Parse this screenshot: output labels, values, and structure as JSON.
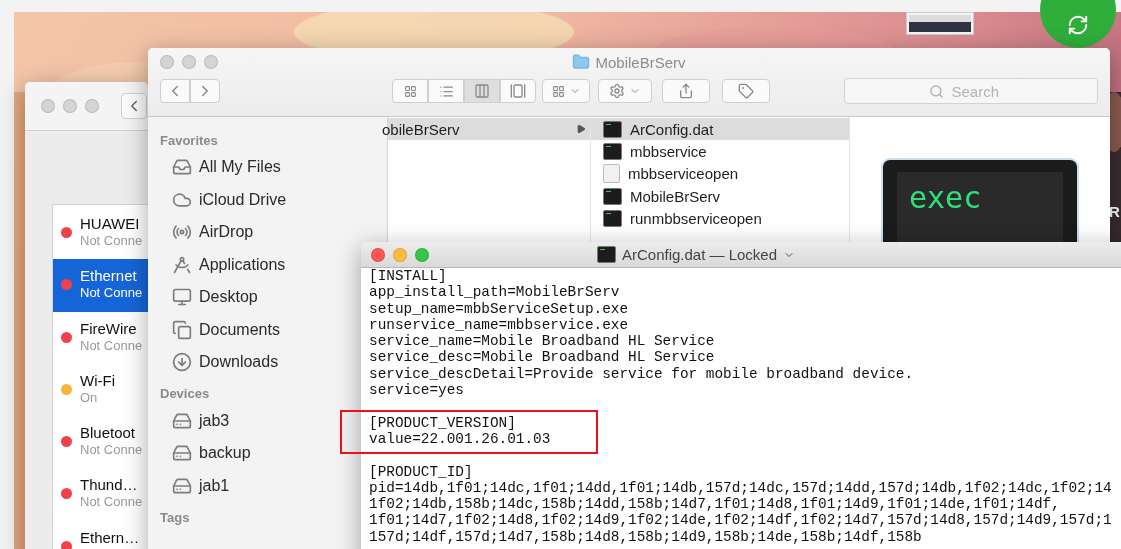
{
  "desktop": {
    "label": "R"
  },
  "network_window": {
    "items": [
      {
        "name": "HUAWEI",
        "status": "Not Conne",
        "color": "#f0414a",
        "selected": false
      },
      {
        "name": "Ethernet",
        "status": "Not Conne",
        "color": "#f0414a",
        "selected": true
      },
      {
        "name": "FireWire",
        "status": "Not Conne",
        "color": "#f0414a",
        "selected": false
      },
      {
        "name": "Wi-Fi",
        "status": "On",
        "color": "#f5b43c",
        "selected": false
      },
      {
        "name": "Bluetoot",
        "status": "Not Conne",
        "color": "#f0414a",
        "selected": false
      },
      {
        "name": "Thund…",
        "status": "Not Conne",
        "color": "#f0414a",
        "selected": false
      },
      {
        "name": "Ethern…",
        "color": "#f0414a",
        "selected": false
      }
    ]
  },
  "finder": {
    "title": "MobileBrServ",
    "search": {
      "placeholder": "Search"
    },
    "sidebar": [
      {
        "heading": "Favorites",
        "items": [
          "All My Files",
          "iCloud Drive",
          "AirDrop",
          "Applications",
          "Desktop",
          "Documents",
          "Downloads"
        ]
      },
      {
        "heading": "Devices",
        "items": [
          "jab3",
          "backup",
          "jab1"
        ]
      },
      {
        "heading": "Tags"
      }
    ],
    "columns": [
      {
        "items": [
          {
            "name": "obileBrServ",
            "kind": "folder",
            "selected": true
          }
        ]
      },
      {
        "items": [
          {
            "name": "ArConfig.dat",
            "kind": "terminal",
            "selected": true
          },
          {
            "name": "mbbservice",
            "kind": "terminal",
            "selected": false
          },
          {
            "name": "mbbserviceopen",
            "kind": "script",
            "selected": false
          },
          {
            "name": "MobileBrServ",
            "kind": "terminal",
            "selected": false
          },
          {
            "name": "runmbbserviceopen",
            "kind": "terminal",
            "selected": false
          }
        ]
      }
    ],
    "preview": {
      "text": "exec"
    }
  },
  "textedit": {
    "title": "ArConfig.dat — Locked",
    "sections": [
      {
        "highlighted": false,
        "lines": [
          "[INSTALL]",
          "app_install_path=MobileBrServ",
          "setup_name=mbbServiceSetup.exe",
          "runservice_name=mbbservice.exe",
          "service_name=Mobile Broadband HL Service",
          "service_desc=Mobile Broadband HL Service",
          "service_descDetail=Provide service for mobile broadband device.",
          "service=yes"
        ]
      },
      {
        "highlighted": true,
        "lines": [
          "[PRODUCT_VERSION]",
          "value=22.001.26.01.03"
        ]
      },
      {
        "highlighted": false,
        "lines": [
          "[PRODUCT_ID]",
          "pid=14db,1f01;14dc,1f01;14dd,1f01;14db,157d;14dc,157d;14dd,157d;14db,1f02;14dc,1f02;14",
          "1f02;14db,158b;14dc,158b;14dd,158b;14d7,1f01;14d8,1f01;14d9,1f01;14de,1f01;14df,",
          "1f01;14d7,1f02;14d8,1f02;14d9,1f02;14de,1f02;14df,1f02;14d7,157d;14d8,157d;14d9,157d;1",
          "157d;14df,157d;14d7,158b;14d8,158b;14d9,158b;14de,158b;14df,158b"
        ]
      }
    ]
  }
}
